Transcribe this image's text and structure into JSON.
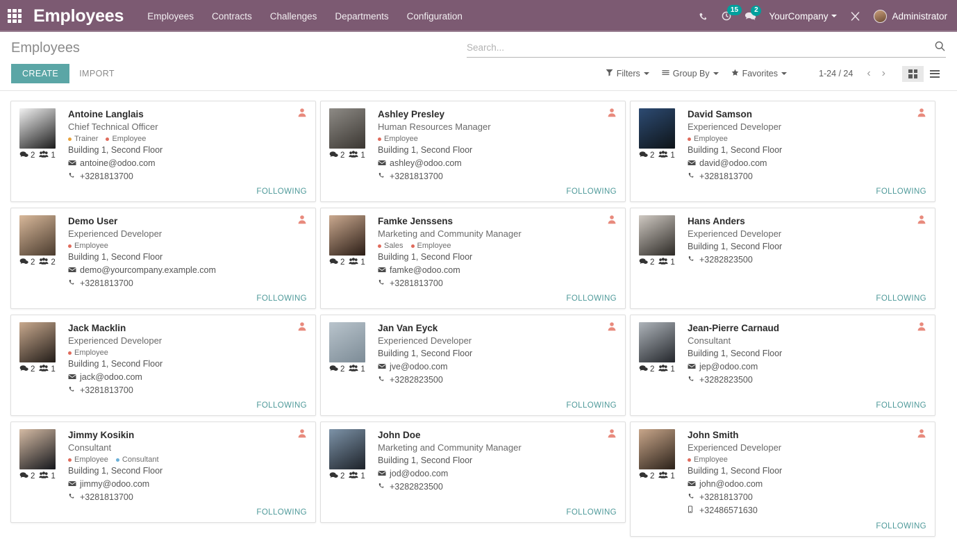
{
  "navbar": {
    "apps_icon": "apps-grid-icon",
    "brand": "Employees",
    "menu": [
      {
        "label": "Employees"
      },
      {
        "label": "Contracts"
      },
      {
        "label": "Challenges"
      },
      {
        "label": "Departments"
      },
      {
        "label": "Configuration"
      }
    ],
    "phone_icon": "phone-icon",
    "activity_icon": "clock-icon",
    "activity_badge": "15",
    "messages_icon": "chat-bubble-icon",
    "messages_badge": "2",
    "company": "YourCompany",
    "debug_icon": "tools-icon",
    "user": "Administrator",
    "brand_color": "#7c5a72",
    "badge_color": "#00a09d"
  },
  "control_panel": {
    "title": "Employees",
    "create_label": "CREATE",
    "import_label": "IMPORT",
    "search_placeholder": "Search...",
    "search_value": "",
    "search_icon": "magnifier-icon",
    "filters_label": "Filters",
    "filters_icon": "funnel-icon",
    "groupby_label": "Group By",
    "groupby_icon": "bars-icon",
    "favorites_label": "Favorites",
    "favorites_icon": "star-icon",
    "pager": "1-24 / 24",
    "prev_icon": "chevron-left-icon",
    "next_icon": "chevron-right-icon",
    "view_kanban_icon": "kanban-view-icon",
    "view_list_icon": "list-view-icon",
    "active_view": "kanban",
    "create_color": "#5ba6a6"
  },
  "card_common": {
    "follow_label": "FOLLOWING",
    "corner_icon": "user-icon",
    "comment_icon": "comment-icon",
    "followers_icon": "users-icon",
    "email_icon": "envelope-icon",
    "phone_icon": "phone-icon",
    "mobile_icon": "mobile-icon",
    "follow_color": "#4f9a9a",
    "corner_color": "#e88a7d"
  },
  "tag_colors": {
    "Trainer": "#e8a33d",
    "Employee": "#e06b5c",
    "Sales": "#e06b5c",
    "Consultant": "#6ab0d8"
  },
  "employees": [
    {
      "name": "Antoine Langlais",
      "job": "Chief Technical Officer",
      "tags": [
        "Trainer",
        "Employee"
      ],
      "location": "Building 1, Second Floor",
      "email": "antoine@odoo.com",
      "phone": "+3281813700",
      "mobile": "",
      "comments": "2",
      "followers": "1",
      "avatar_from": "#f2f2f2",
      "avatar_to": "#1b1b1b"
    },
    {
      "name": "Ashley Presley",
      "job": "Human Resources Manager",
      "tags": [
        "Employee"
      ],
      "location": "Building 1, Second Floor",
      "email": "ashley@odoo.com",
      "phone": "+3281813700",
      "mobile": "",
      "comments": "2",
      "followers": "1",
      "avatar_from": "#8e8b86",
      "avatar_to": "#3a3631"
    },
    {
      "name": "David Samson",
      "job": "Experienced Developer",
      "tags": [
        "Employee"
      ],
      "location": "Building 1, Second Floor",
      "email": "david@odoo.com",
      "phone": "+3281813700",
      "mobile": "",
      "comments": "2",
      "followers": "1",
      "avatar_from": "#2d4b73",
      "avatar_to": "#0e1418"
    },
    {
      "name": "Demo User",
      "job": "Experienced Developer",
      "tags": [
        "Employee"
      ],
      "location": "Building 1, Second Floor",
      "email": "demo@yourcompany.example.com",
      "phone": "+3281813700",
      "mobile": "",
      "comments": "2",
      "followers": "2",
      "avatar_from": "#d8b89a",
      "avatar_to": "#4a3b2e"
    },
    {
      "name": "Famke Jenssens",
      "job": "Marketing and Community Manager",
      "tags": [
        "Sales",
        "Employee"
      ],
      "location": "Building 1, Second Floor",
      "email": "famke@odoo.com",
      "phone": "+3281813700",
      "mobile": "",
      "comments": "2",
      "followers": "1",
      "avatar_from": "#caa98f",
      "avatar_to": "#2a1c15"
    },
    {
      "name": "Hans Anders",
      "job": "Experienced Developer",
      "tags": [],
      "location": "Building 1, Second Floor",
      "email": "",
      "phone": "+3282823500",
      "mobile": "",
      "comments": "2",
      "followers": "1",
      "avatar_from": "#cfc9c2",
      "avatar_to": "#2c2925"
    },
    {
      "name": "Jack Macklin",
      "job": "Experienced Developer",
      "tags": [
        "Employee"
      ],
      "location": "Building 1, Second Floor",
      "email": "jack@odoo.com",
      "phone": "+3281813700",
      "mobile": "",
      "comments": "2",
      "followers": "1",
      "avatar_from": "#c8a98e",
      "avatar_to": "#221c18"
    },
    {
      "name": "Jan Van Eyck",
      "job": "Experienced Developer",
      "tags": [],
      "location": "Building 1, Second Floor",
      "email": "jve@odoo.com",
      "phone": "+3282823500",
      "mobile": "",
      "comments": "2",
      "followers": "1",
      "avatar_from": "#b9c4cc",
      "avatar_to": "#7c8b96"
    },
    {
      "name": "Jean-Pierre Carnaud",
      "job": "Consultant",
      "tags": [],
      "location": "Building 1, Second Floor",
      "email": "jep@odoo.com",
      "phone": "+3282823500",
      "mobile": "",
      "comments": "2",
      "followers": "1",
      "avatar_from": "#aeb4ba",
      "avatar_to": "#23262b"
    },
    {
      "name": "Jimmy Kosikin",
      "job": "Consultant",
      "tags": [
        "Employee",
        "Consultant"
      ],
      "location": "Building 1, Second Floor",
      "email": "jimmy@odoo.com",
      "phone": "+3281813700",
      "mobile": "",
      "comments": "2",
      "followers": "1",
      "avatar_from": "#d5bba4",
      "avatar_to": "#15171c"
    },
    {
      "name": "John Doe",
      "job": "Marketing and Community Manager",
      "tags": [],
      "location": "Building 1, Second Floor",
      "email": "jod@odoo.com",
      "phone": "+3282823500",
      "mobile": "",
      "comments": "2",
      "followers": "1",
      "avatar_from": "#7d93a8",
      "avatar_to": "#1d2229"
    },
    {
      "name": "John Smith",
      "job": "Experienced Developer",
      "tags": [
        "Employee"
      ],
      "location": "Building 1, Second Floor",
      "email": "john@odoo.com",
      "phone": "+3281813700",
      "mobile": "+32486571630",
      "comments": "2",
      "followers": "1",
      "avatar_from": "#c8a68a",
      "avatar_to": "#2b2119"
    }
  ]
}
